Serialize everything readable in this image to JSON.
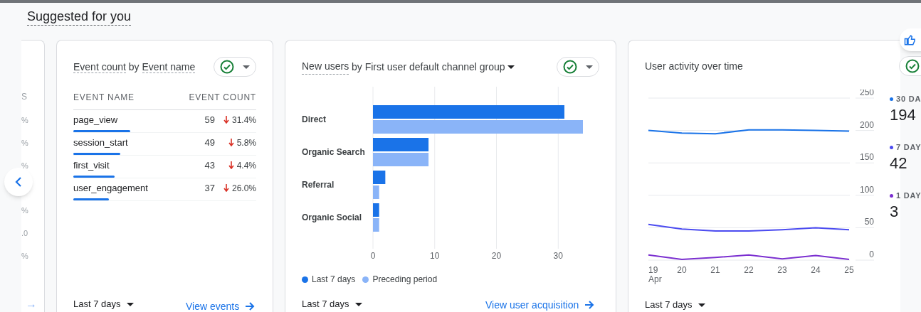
{
  "section_title": "Suggested for you",
  "partial_card": {
    "header": "S",
    "cells_top": [
      "%",
      "%",
      "%"
    ],
    "cells_bottom": [
      "%",
      ".0",
      "%"
    ],
    "link_arrow": "→"
  },
  "event_card": {
    "title_parts": [
      "Event count",
      "by",
      "Event name"
    ],
    "columns": [
      "EVENT NAME",
      "EVENT COUNT"
    ],
    "rows": [
      {
        "name": "page_view",
        "count": "59",
        "change": "31.4%"
      },
      {
        "name": "session_start",
        "count": "49",
        "change": "5.8%"
      },
      {
        "name": "first_visit",
        "count": "43",
        "change": "4.4%"
      },
      {
        "name": "user_engagement",
        "count": "37",
        "change": "26.0%"
      }
    ],
    "range": "Last 7 days",
    "link": "View events"
  },
  "users_card": {
    "title_parts": [
      "New users",
      "by First user default channel group"
    ],
    "chart_data": {
      "type": "bar",
      "orientation": "horizontal",
      "categories": [
        "Direct",
        "Organic Search",
        "Referral",
        "Organic Social"
      ],
      "series": [
        {
          "name": "Last 7 days",
          "color": "#1a73e8",
          "values": [
            31,
            9,
            2,
            1
          ]
        },
        {
          "name": "Preceding period",
          "color": "#8ab4f8",
          "values": [
            34,
            9,
            1,
            1
          ]
        }
      ],
      "xticks": [
        0,
        10,
        20,
        30
      ],
      "xlim": [
        0,
        34
      ],
      "grid": true
    },
    "range": "Last 7 days",
    "link": "View user acquisition"
  },
  "activity_card": {
    "title": "User activity over time",
    "chart_data": {
      "type": "line",
      "categories": [
        "19",
        "20",
        "21",
        "22",
        "23",
        "24",
        "25"
      ],
      "grid": true,
      "series": [
        {
          "name": "30 DA",
          "color": "#1a73e8",
          "values": [
            200,
            196,
            195,
            201,
            201,
            200,
            199
          ]
        },
        {
          "name": "7 DAY",
          "color": "#4b4bf0",
          "values": [
            55,
            48,
            45,
            45,
            47,
            50,
            47
          ]
        },
        {
          "name": "1 DAY",
          "color": "#7b2fd0",
          "values": [
            8,
            1,
            4,
            8,
            2,
            7,
            1
          ]
        }
      ],
      "yticks": [
        0,
        50,
        100,
        150,
        200,
        250
      ],
      "ylim": [
        0,
        250
      ]
    },
    "month_label": "Apr",
    "legend_values": [
      "194",
      "42",
      "3"
    ],
    "range": "Last 7 days"
  }
}
